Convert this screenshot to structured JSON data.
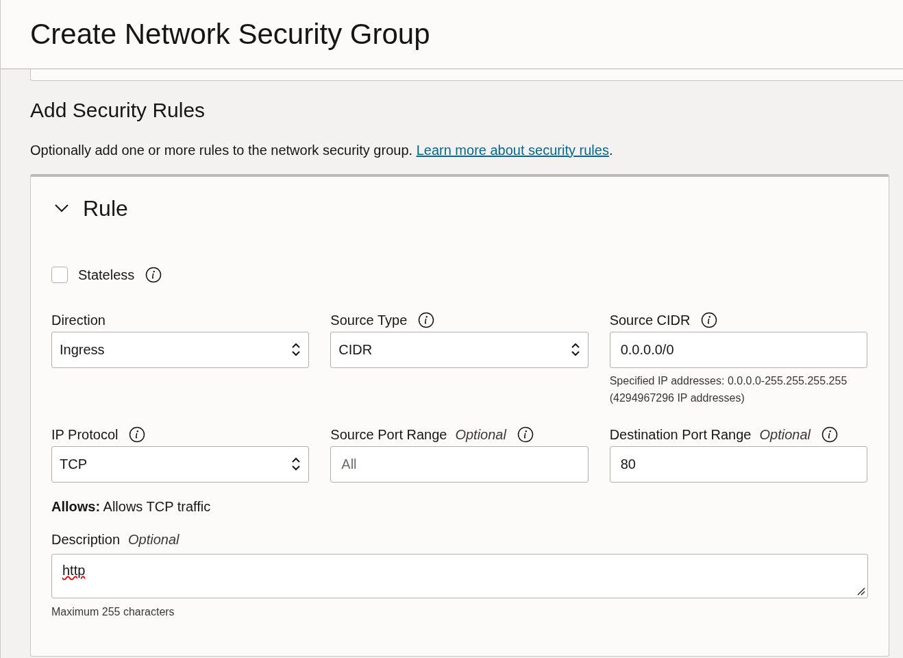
{
  "header": {
    "title": "Create Network Security Group"
  },
  "section": {
    "title": "Add Security Rules",
    "intro": "Optionally add one or more rules to the network security group.",
    "link": "Learn more about security rules",
    "after_link": "."
  },
  "rule": {
    "title": "Rule",
    "expanded": true,
    "stateless": {
      "label": "Stateless",
      "checked": false,
      "info": true
    },
    "fields": [
      {
        "kind": "select",
        "label": "Direction",
        "info": false,
        "value": "Ingress"
      },
      {
        "kind": "select",
        "label": "Source Type",
        "info": true,
        "value": "CIDR"
      },
      {
        "kind": "text",
        "label": "Source CIDR",
        "info": true,
        "value": "0.0.0.0/0",
        "helper": "Specified IP addresses: 0.0.0.0-255.255.255.255 (4294967296 IP addresses)"
      },
      {
        "kind": "select",
        "label": "IP Protocol",
        "info": true,
        "value": "TCP"
      },
      {
        "kind": "text",
        "label": "Source Port Range",
        "optional": "Optional",
        "info": true,
        "placeholder": "All"
      },
      {
        "kind": "text",
        "label": "Destination Port Range",
        "optional": "Optional",
        "info": true,
        "value": "80"
      }
    ],
    "allows": "**Allows:** Allows TCP traffic",
    "description": {
      "label": "Description",
      "optional": "Optional",
      "value": "http",
      "helper": "Maximum 255 characters"
    }
  }
}
